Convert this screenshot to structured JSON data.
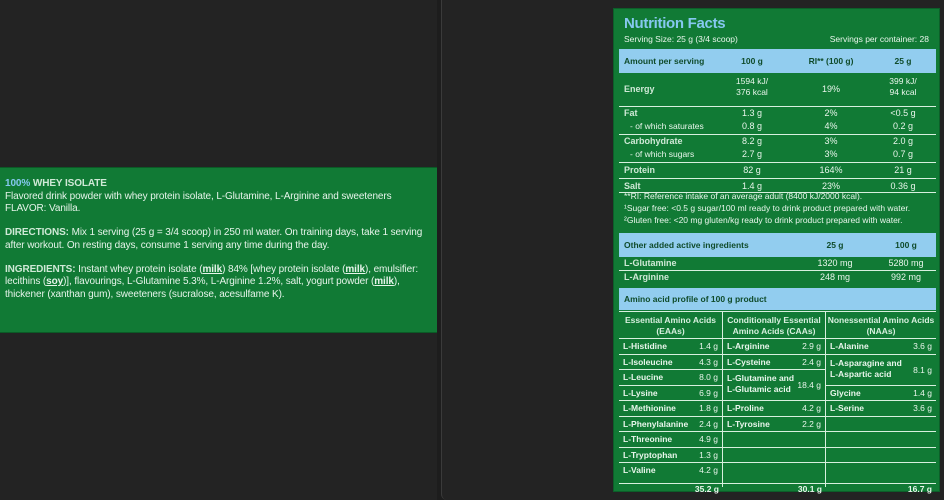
{
  "left": {
    "title_pct": "100%",
    "title_rest": " WHEY ISOLATE",
    "desc_line1": "Flavored drink powder with whey protein isolate, L-Glutamine, L-Arginine and sweeteners",
    "flavor": "FLAVOR: Vanilla.",
    "directions_label": "DIRECTIONS:",
    "directions_text": " Mix 1 serving (25 g = 3/4 scoop) in 250 ml water. On training days, take 1 serving after workout. On resting days, consume 1 serving any time during the day.",
    "ingredients_label": "INGREDIENTS:",
    "ing_a": " Instant whey protein isolate (",
    "ing_milk1": "milk",
    "ing_b": ") 84% [whey protein isolate (",
    "ing_milk2": "milk",
    "ing_c": "), emulsifier: lecithins (",
    "ing_soy": "soy",
    "ing_d": ")], flavourings, L-Glutamine 5.3%, L-Arginine 1.2%, salt, yogurt powder (",
    "ing_milk3": "milk",
    "ing_e": "), thickener (xanthan gum), sweeteners (sucralose, acesulfame K)."
  },
  "nutrition": {
    "title": "Nutrition Facts",
    "serving_size": "Serving Size: 25 g (3/4 scoop)",
    "servings_per_container": "Servings per container: 28",
    "header": {
      "label": "Amount per serving",
      "col1": "100 g",
      "col2": "RI** (100 g)",
      "col3": "25 g"
    },
    "energy": {
      "label": "Energy",
      "v100a": "1594 kJ/",
      "v100b": "376 kcal",
      "ri": "19%",
      "v25a": "399 kJ/",
      "v25b": "94 kcal"
    },
    "fat": {
      "label": "Fat",
      "v100": "1.3 g",
      "ri": "2%",
      "v25": "<0.5 g"
    },
    "saturates": {
      "label": "- of which saturates",
      "v100": "0.8 g",
      "ri": "4%",
      "v25": "0.2 g"
    },
    "carbohydrate": {
      "label": "Carbohydrate",
      "v100": "8.2 g",
      "ri": "3%",
      "v25": "2.0 g"
    },
    "sugars": {
      "label": "- of which sugars",
      "v100": "2.7 g",
      "ri": "3%",
      "v25": "0.7 g"
    },
    "protein": {
      "label": "Protein",
      "v100": "82 g",
      "ri": "164%",
      "v25": "21 g"
    },
    "salt": {
      "label": "Salt",
      "v100": "1.4 g",
      "ri": "23%",
      "v25": "0.36 g"
    },
    "notes": [
      "**RI: Reference intake of an average adult (8400 kJ/2000 kcal).",
      "¹Sugar free: <0.5 g sugar/100 ml ready to drink product prepared with water.",
      "²Gluten free: <20 mg gluten/kg ready to drink product prepared with water."
    ],
    "active_header": {
      "label": "Other added active ingredients",
      "col1": "25 g",
      "col2": "100 g"
    },
    "glutamine": {
      "label": "L-Glutamine",
      "v25": "1320 mg",
      "v100": "5280 mg"
    },
    "arginine": {
      "label": "L-Arginine",
      "v25": "248 mg",
      "v100": "992 mg"
    },
    "amino_header": "Amino acid profile of 100 g product",
    "eaa_title": "Essential Amino Acids (EAAs)",
    "caa_title": "Conditionally Essential Amino Acids (CAAs)",
    "naa_title": "Nonessential Amino Acids (NAAs)",
    "eaa": [
      {
        "name": "L-Histidine",
        "value": "1.4 g"
      },
      {
        "name": "L-Isoleucine",
        "value": "4.3 g"
      },
      {
        "name": "L-Leucine",
        "value": "8.0 g"
      },
      {
        "name": "L-Lysine",
        "value": "6.9 g"
      },
      {
        "name": "L-Methionine",
        "value": "1.8 g"
      },
      {
        "name": "L-Phenylalanine",
        "value": "2.4 g"
      },
      {
        "name": "L-Threonine",
        "value": "4.9 g"
      },
      {
        "name": "L-Tryptophan",
        "value": "1.3 g"
      },
      {
        "name": "L-Valine",
        "value": "4.2 g"
      }
    ],
    "caa": [
      {
        "name": "L-Arginine",
        "value": "2.9 g"
      },
      {
        "name": "L-Cysteine",
        "value": "2.4 g"
      },
      {
        "name": "L-Glutamine and L-Glutamic acid",
        "value": "18.4 g"
      },
      {
        "name": "L-Proline",
        "value": "4.2 g"
      },
      {
        "name": "L-Tyrosine",
        "value": "2.2 g"
      }
    ],
    "naa": [
      {
        "name": "L-Alanine",
        "value": "3.6 g"
      },
      {
        "name": "L-Asparagine and L-Aspartic acid",
        "value": "8.1 g"
      },
      {
        "name": "Glycine",
        "value": "1.4 g"
      },
      {
        "name": "L-Serine",
        "value": "3.6 g"
      }
    ],
    "totals": {
      "eaa": "35.2 g",
      "caa": "30.1 g",
      "naa": "16.7 g"
    }
  }
}
